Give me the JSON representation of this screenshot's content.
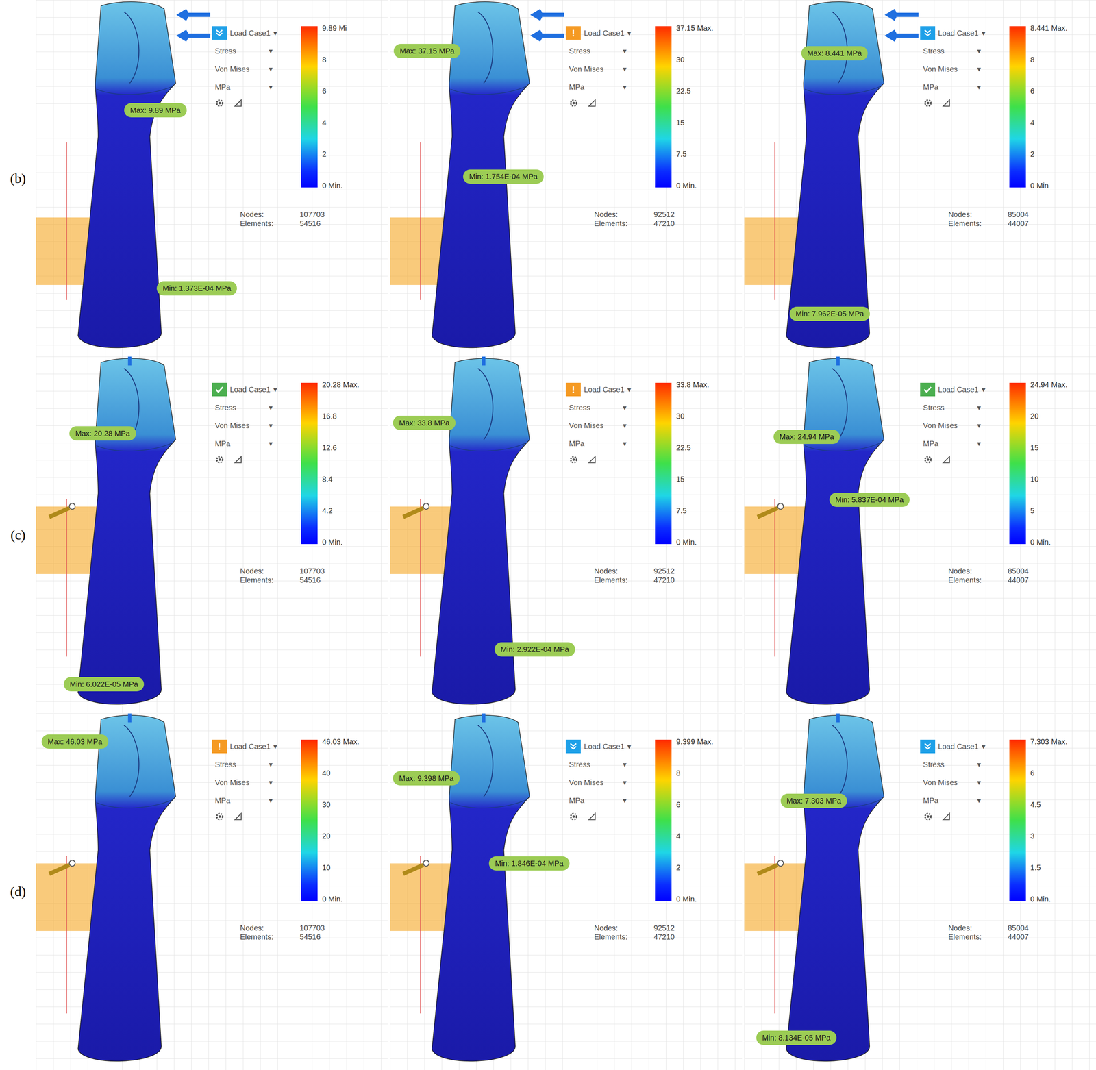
{
  "figure": {
    "dropdown_caret": "▾",
    "rows": [
      {
        "label": "(b)",
        "panels": [
          {
            "status": {
              "kind": "info",
              "color": "#1ea0e8"
            },
            "load_case": "Load Case1",
            "result": "Stress",
            "criterion": "Von Mises",
            "unit": "MPa",
            "legend": {
              "max": "9.89 Mi",
              "ticks": [
                "8",
                "6",
                "4",
                "2"
              ],
              "min": "0 Min."
            },
            "max_label": "Max: 9.89 MPa",
            "min_label": "Min: 1.373E-04 MPa",
            "nodes_label": "Nodes:",
            "nodes": "107703",
            "elements_label": "Elements:",
            "elements": "54516"
          },
          {
            "status": {
              "kind": "warning",
              "color": "#f59a23"
            },
            "load_case": "Load Case1",
            "result": "Stress",
            "criterion": "Von Mises",
            "unit": "MPa",
            "legend": {
              "max": "37.15 Max.",
              "ticks": [
                "30",
                "22.5",
                "15",
                "7.5"
              ],
              "min": "0 Min."
            },
            "max_label": "Max: 37.15 MPa",
            "min_label": "Min: 1.754E-04 MPa",
            "nodes_label": "Nodes:",
            "nodes": "92512",
            "elements_label": "Elements:",
            "elements": "47210"
          },
          {
            "status": {
              "kind": "info",
              "color": "#1ea0e8"
            },
            "load_case": "Load Case1",
            "result": "Stress",
            "criterion": "Von Mises",
            "unit": "MPa",
            "legend": {
              "max": "8.441 Max.",
              "ticks": [
                "8",
                "6",
                "4",
                "2"
              ],
              "min": "0 Min"
            },
            "max_label": "Max: 8.441 MPa",
            "min_label": "Min: 7.962E-05 MPa",
            "nodes_label": "Nodes:",
            "nodes": "85004",
            "elements_label": "Elements:",
            "elements": "44007"
          }
        ]
      },
      {
        "label": "(c)",
        "panels": [
          {
            "status": {
              "kind": "ok",
              "color": "#4caf50"
            },
            "load_case": "Load Case1",
            "result": "Stress",
            "criterion": "Von Mises",
            "unit": "MPa",
            "legend": {
              "max": "20.28 Max.",
              "ticks": [
                "16.8",
                "12.6",
                "8.4",
                "4.2"
              ],
              "min": "0 Min."
            },
            "max_label": "Max: 20.28 MPa",
            "min_label": "Min: 6.022E-05 MPa",
            "nodes_label": "Nodes:",
            "nodes": "107703",
            "elements_label": "Elements:",
            "elements": "54516"
          },
          {
            "status": {
              "kind": "warning",
              "color": "#f59a23"
            },
            "load_case": "Load Case1",
            "result": "Stress",
            "criterion": "Von Mises",
            "unit": "MPa",
            "legend": {
              "max": "33.8 Max.",
              "ticks": [
                "30",
                "22.5",
                "15",
                "7.5"
              ],
              "min": "0 Min."
            },
            "max_label": "Max: 33.8 MPa",
            "min_label": "Min: 2.922E-04 MPa",
            "nodes_label": "Nodes:",
            "nodes": "92512",
            "elements_label": "Elements:",
            "elements": "47210"
          },
          {
            "status": {
              "kind": "ok",
              "color": "#4caf50"
            },
            "load_case": "Load Case1",
            "result": "Stress",
            "criterion": "Von Mises",
            "unit": "MPa",
            "legend": {
              "max": "24.94 Max.",
              "ticks": [
                "20",
                "15",
                "10",
                "5"
              ],
              "min": "0 Min."
            },
            "max_label": "Max: 24.94 MPa",
            "min_label": "Min: 5.837E-04 MPa",
            "nodes_label": "Nodes:",
            "nodes": "85004",
            "elements_label": "Elements:",
            "elements": "44007"
          }
        ]
      },
      {
        "label": "(d)",
        "panels": [
          {
            "status": {
              "kind": "warning",
              "color": "#f59a23"
            },
            "load_case": "Load Case1",
            "result": "Stress",
            "criterion": "Von Mises",
            "unit": "MPa",
            "legend": {
              "max": "46.03 Max.",
              "ticks": [
                "40",
                "30",
                "20",
                "10"
              ],
              "min": "0 Min."
            },
            "max_label": "Max: 46.03 MPa",
            "nodes_label": "Nodes:",
            "nodes": "107703",
            "elements_label": "Elements:",
            "elements": "54516"
          },
          {
            "status": {
              "kind": "info",
              "color": "#1ea0e8"
            },
            "load_case": "Load Case1",
            "result": "Stress",
            "criterion": "Von Mises",
            "unit": "MPa",
            "legend": {
              "max": "9.399 Max.",
              "ticks": [
                "8",
                "6",
                "4",
                "2"
              ],
              "min": "0 Min."
            },
            "max_label": "Max: 9.398 MPa",
            "min_label": "Min: 1.846E-04 MPa",
            "nodes_label": "Nodes:",
            "nodes": "92512",
            "elements_label": "Elements:",
            "elements": "47210"
          },
          {
            "status": {
              "kind": "info",
              "color": "#1ea0e8"
            },
            "load_case": "Load Case1",
            "result": "Stress",
            "criterion": "Von Mises",
            "unit": "MPa",
            "legend": {
              "max": "7.303 Max.",
              "ticks": [
                "6",
                "4.5",
                "3",
                "1.5"
              ],
              "min": "0 Min."
            },
            "max_label": "Max: 7.303 MPa",
            "min_label": "Min: 8.134E-05 MPa",
            "nodes_label": "Nodes:",
            "nodes": "85004",
            "elements_label": "Elements:",
            "elements": "44007"
          }
        ]
      }
    ]
  }
}
